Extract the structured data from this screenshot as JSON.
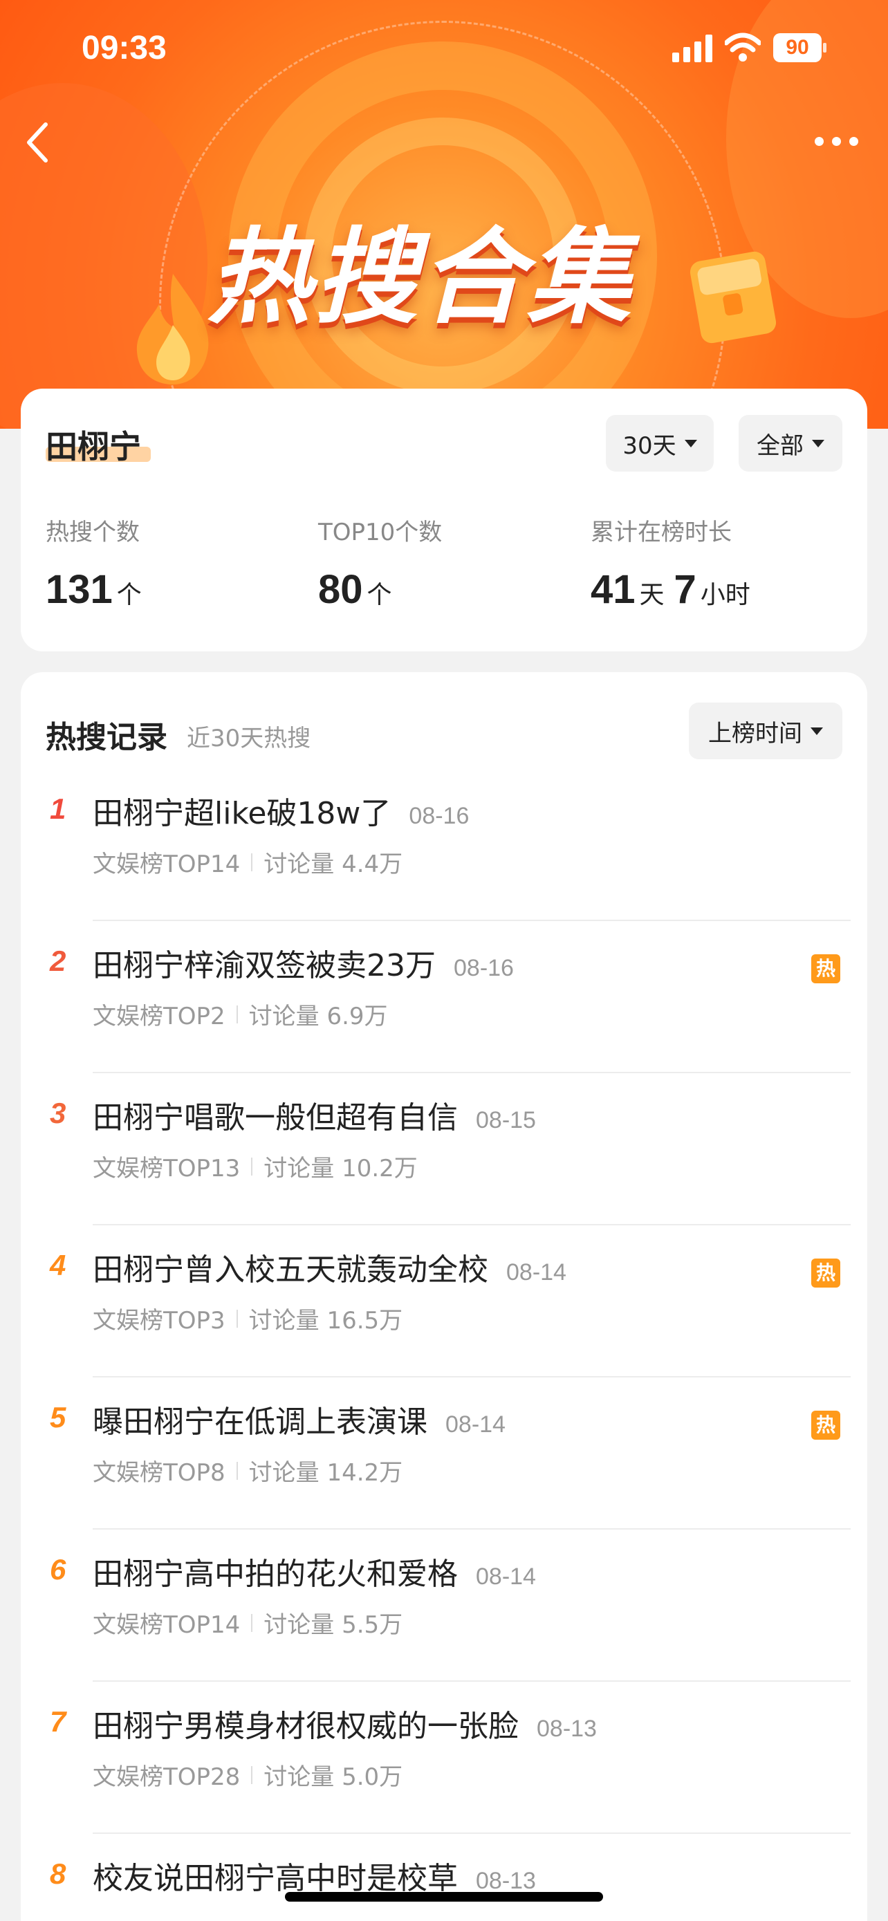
{
  "status_bar": {
    "time": "09:33",
    "battery": "90"
  },
  "header": {
    "title": "热搜合集"
  },
  "summary": {
    "name": "田栩宁",
    "filter_days": "30天",
    "filter_scope": "全部",
    "stats": [
      {
        "label": "热搜个数",
        "value": "131",
        "unit": "个"
      },
      {
        "label": "TOP10个数",
        "value": "80",
        "unit": "个"
      },
      {
        "label": "累计在榜时长",
        "value": "41",
        "unit": "天",
        "value2": "7",
        "unit2": "小时"
      }
    ]
  },
  "records": {
    "title": "热搜记录",
    "subtitle": "近30天热搜",
    "sort_label": "上榜时间",
    "hot_label": "热",
    "items": [
      {
        "rank": "1",
        "title": "田栩宁超like破18w了",
        "date": "08-16",
        "board": "文娱榜TOP14",
        "discussion": "讨论量 4.4万",
        "hot": false,
        "rank_color": "#f04a3c"
      },
      {
        "rank": "2",
        "title": "田栩宁梓渝双签被卖23万",
        "date": "08-16",
        "board": "文娱榜TOP2",
        "discussion": "讨论量 6.9万",
        "hot": true,
        "rank_color": "#f05a3c"
      },
      {
        "rank": "3",
        "title": "田栩宁唱歌一般但超有自信",
        "date": "08-15",
        "board": "文娱榜TOP13",
        "discussion": "讨论量 10.2万",
        "hot": false,
        "rank_color": "#f2673a"
      },
      {
        "rank": "4",
        "title": "田栩宁曾入校五天就轰动全校",
        "date": "08-14",
        "board": "文娱榜TOP3",
        "discussion": "讨论量 16.5万",
        "hot": true,
        "rank_color": "#ff8c1a"
      },
      {
        "rank": "5",
        "title": "曝田栩宁在低调上表演课",
        "date": "08-14",
        "board": "文娱榜TOP8",
        "discussion": "讨论量 14.2万",
        "hot": true,
        "rank_color": "#ff8c1a"
      },
      {
        "rank": "6",
        "title": "田栩宁高中拍的花火和爱格",
        "date": "08-14",
        "board": "文娱榜TOP14",
        "discussion": "讨论量 5.5万",
        "hot": false,
        "rank_color": "#ff8c1a"
      },
      {
        "rank": "7",
        "title": "田栩宁男模身材很权威的一张脸",
        "date": "08-13",
        "board": "文娱榜TOP28",
        "discussion": "讨论量 5.0万",
        "hot": false,
        "rank_color": "#ff8c1a"
      },
      {
        "rank": "8",
        "title": "校友说田栩宁高中时是校草",
        "date": "08-13",
        "board": "",
        "discussion": "",
        "hot": false,
        "rank_color": "#ff8c1a"
      }
    ]
  },
  "colors": {
    "accent": "#ff6a1a",
    "hot_badge": "#ff9a1a",
    "underline": "#ffd3a3"
  }
}
